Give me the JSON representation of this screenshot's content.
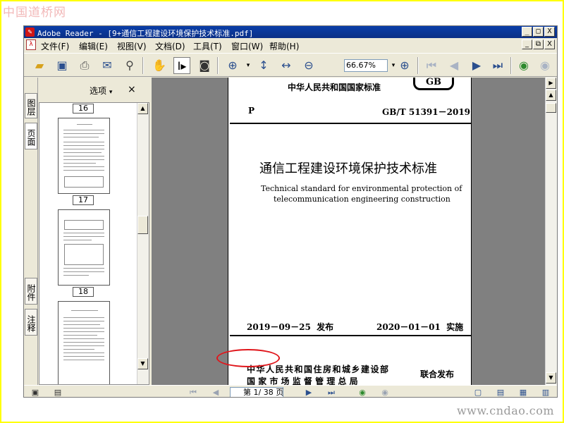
{
  "watermarks": {
    "top": "中国道桥网",
    "bottom": "www.cndao.com"
  },
  "window": {
    "title": "Adobe Reader - [9+通信工程建设环境保护技术标准.pdf]",
    "controls": [
      "_",
      "□",
      "X"
    ]
  },
  "menu": [
    "文件(F)",
    "编辑(E)",
    "视图(V)",
    "文档(D)",
    "工具(T)",
    "窗口(W)",
    "帮助(H)"
  ],
  "menu_controls": [
    "_",
    "⧉",
    "X"
  ],
  "toolbar": {
    "zoom": "66.67%",
    "icons": [
      "open-icon",
      "save-icon",
      "print-icon",
      "email-icon",
      "search-icon",
      "hand-icon",
      "select-icon",
      "snapshot-icon",
      "zoom-in-icon",
      "fit-page-icon",
      "fit-width-icon",
      "zoom-out-icon",
      "zoom-plus-icon",
      "first-page-icon",
      "prev-page-icon",
      "next-page-icon",
      "last-page-icon",
      "back-icon",
      "forward-icon"
    ]
  },
  "side_tabs": [
    "图层",
    "页面",
    "附件",
    "注释"
  ],
  "pages_panel": {
    "options_label": "选项",
    "close": "×",
    "page_labels": [
      "16",
      "17",
      "18"
    ]
  },
  "document": {
    "header": "中华人民共和国国家标准",
    "logo": "GB",
    "classification": "P",
    "code": "GB/T 51391－2019",
    "title_cn": "通信工程建设环境保护技术标准",
    "title_en_1": "Technical standard for environmental protection of",
    "title_en_2": "telecommunication engineering construction",
    "issue_date": "2019－09－25  发布",
    "effective_date": "2020－01－01  实施",
    "issuer_1": "中华人民共和国住房和城乡建设部",
    "issuer_2": "国 家 市 场 监 督 管 理 总 局",
    "joint": "联合发布"
  },
  "statusbar": {
    "page_indicator": "第 1/ 38 页"
  }
}
